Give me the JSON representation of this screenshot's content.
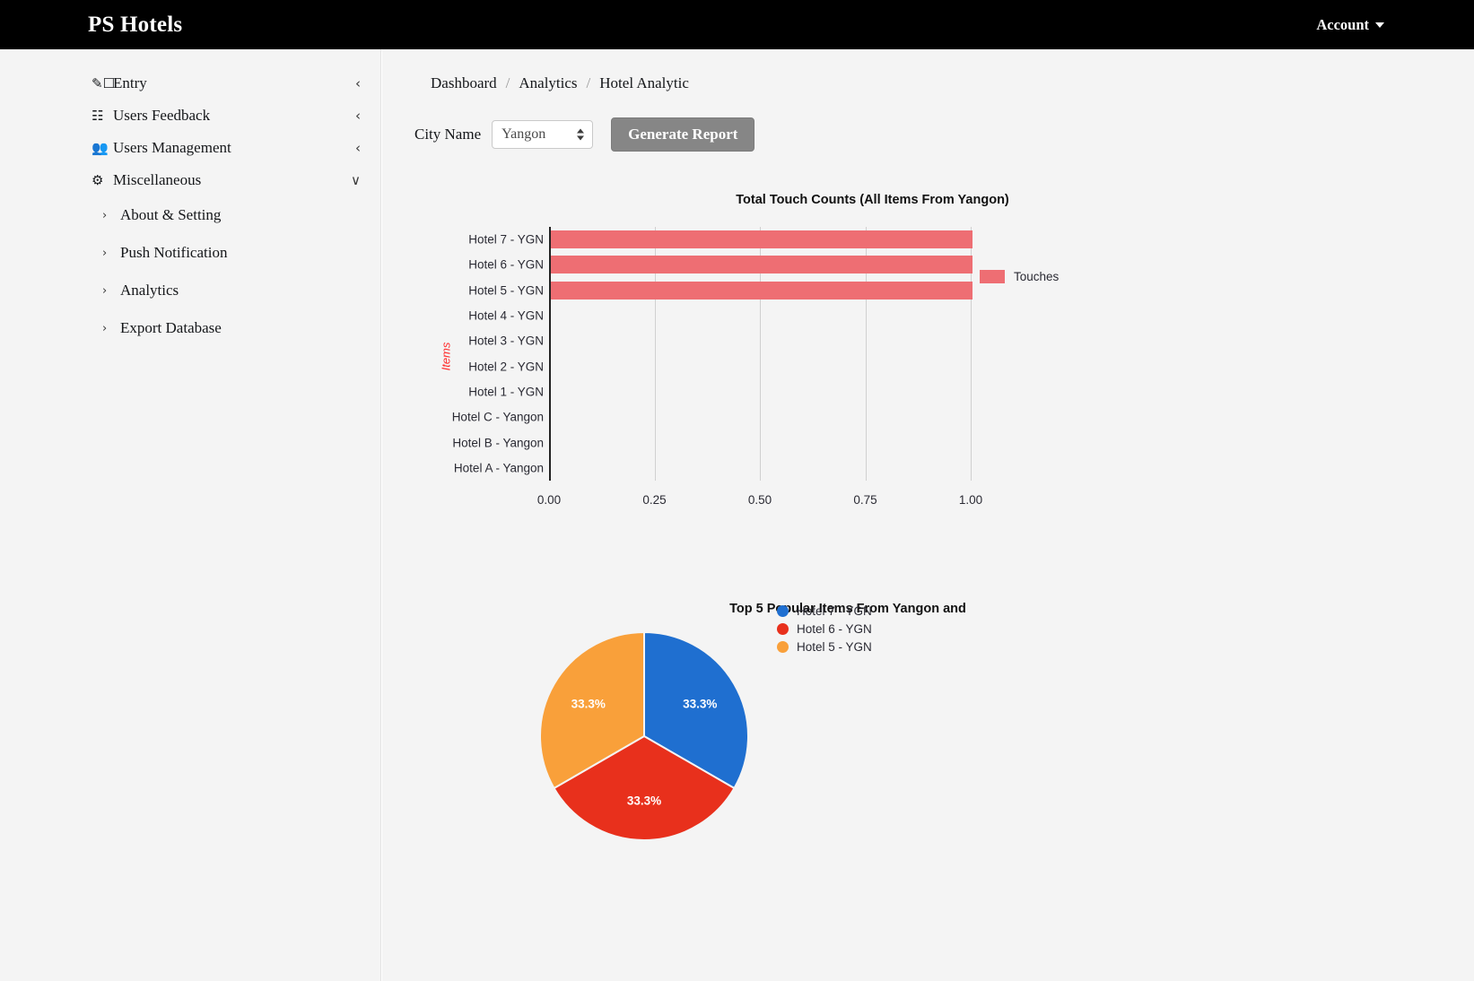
{
  "navbar": {
    "brand": "PS Hotels",
    "account_label": "Account",
    "caret_icon": "chevron-down-icon"
  },
  "sidebar": {
    "items": [
      {
        "label": "Entry",
        "icon": "pencil-square-icon",
        "chevron": "‹"
      },
      {
        "label": "Users Feedback",
        "icon": "list-box-icon",
        "chevron": "‹"
      },
      {
        "label": "Users Management",
        "icon": "users-group-icon",
        "chevron": "‹"
      },
      {
        "label": "Miscellaneous",
        "icon": "gears-icon",
        "chevron": "∨"
      }
    ],
    "sub_items": [
      {
        "label": "About & Setting",
        "arrow": "›"
      },
      {
        "label": "Push Notification",
        "arrow": "›"
      },
      {
        "label": "Analytics",
        "arrow": "›"
      },
      {
        "label": "Export Database",
        "arrow": "›"
      }
    ]
  },
  "breadcrumb": {
    "items": [
      "Dashboard",
      "Analytics",
      "Hotel Analytic"
    ],
    "separator": "/"
  },
  "controls": {
    "city_label": "City Name",
    "city_value": "Yangon",
    "city_options": [
      "Yangon"
    ],
    "generate_label": "Generate Report"
  },
  "chart_data": [
    {
      "type": "bar",
      "orientation": "horizontal",
      "title": "Total Touch Counts (All Items From Yangon)",
      "xlabel": "",
      "ylabel": "Items",
      "ylabel_color": "#ff2b2b",
      "xlim": [
        0,
        1.0
      ],
      "xticks": [
        "0.00",
        "0.25",
        "0.50",
        "0.75",
        "1.00"
      ],
      "xtick_values": [
        0,
        0.25,
        0.5,
        0.75,
        1.0
      ],
      "grid": true,
      "legend": [
        "Touches"
      ],
      "legend_position": "right",
      "series_color": "#ee6e73",
      "categories": [
        "Hotel 7 - YGN",
        "Hotel 6 - YGN",
        "Hotel 5 - YGN",
        "Hotel 4 - YGN",
        "Hotel 3 - YGN",
        "Hotel 2 - YGN",
        "Hotel 1 - YGN",
        "Hotel C - Yangon",
        "Hotel B - Yangon",
        "Hotel A - Yangon"
      ],
      "values": [
        1.0,
        1.0,
        1.0,
        0,
        0,
        0,
        0,
        0,
        0,
        0
      ]
    },
    {
      "type": "pie",
      "title": "Top 5 Popular Items From Yangon and",
      "labels": [
        "Hotel 7 - YGN",
        "Hotel 6 - YGN",
        "Hotel 5 - YGN"
      ],
      "values": [
        33.3,
        33.3,
        33.3
      ],
      "value_labels": [
        "33.3%",
        "33.3%",
        "33.3%"
      ],
      "colors": [
        "#1f6fd0",
        "#e8301c",
        "#f9a03a"
      ],
      "legend_position": "right",
      "start_angle_deg": 0
    }
  ]
}
